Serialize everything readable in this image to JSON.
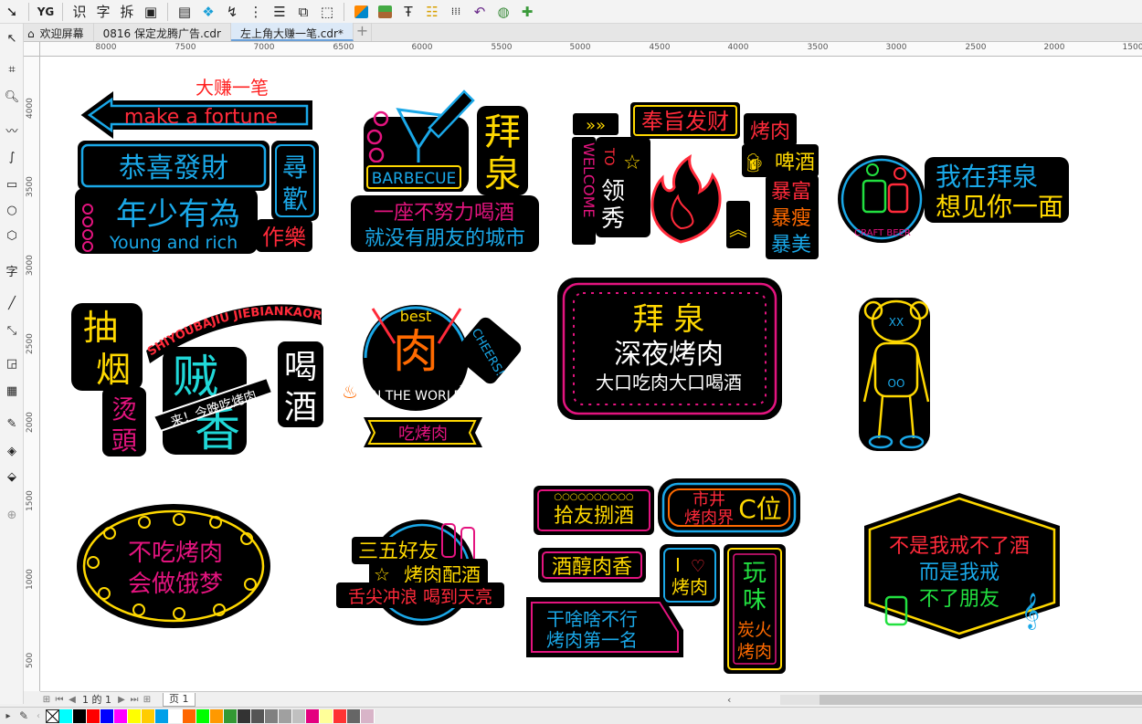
{
  "toolbar": {
    "items": [
      "select",
      "yg",
      "识",
      "字",
      "拆",
      "paste",
      "table",
      "dot",
      "step",
      "dist",
      "bar",
      "pos",
      "trim",
      "c1",
      "c2",
      "c3",
      "c4",
      "c5",
      "c6",
      "c7",
      "c8"
    ]
  },
  "tabs": {
    "home": "欢迎屏幕",
    "t1": "0816 保定龙腾广告.cdr",
    "t2": "左上角大赚一笔.cdr*",
    "add": "+"
  },
  "ruler": {
    "h": [
      "8000",
      "7500",
      "7000",
      "6500",
      "6000",
      "5500",
      "5000",
      "4500",
      "4000",
      "3500",
      "3000",
      "2500",
      "2000",
      "1500"
    ],
    "v": [
      "4000",
      "3500",
      "3000",
      "2500",
      "2000",
      "1500",
      "1000",
      "500"
    ]
  },
  "canvas": {
    "s1": {
      "title": "大赚一笔",
      "arrow": "make a fortune",
      "l1": "恭喜發財",
      "l2": "年少有為",
      "l3": "Young and rich",
      "v1": "尋",
      "v2": "歡",
      "v3": "作樂"
    },
    "s2": {
      "ch1": "拜",
      "ch2": "泉",
      "badge": "BARBECUE",
      "l1": "一座不努力喝酒",
      "l2": "就没有朋友的城市"
    },
    "s3": {
      "top": "奉旨发财",
      "side": "WELCOME",
      "to": "TO",
      "c1": "领",
      "c2": "秀",
      "r1": "烤肉",
      "r2": "啤酒",
      "r3": "暴富",
      "r4": "暴瘦",
      "r5": "暴美"
    },
    "s4": {
      "l1": "我在拜泉",
      "l2": "想见你一面",
      "tag": "CRAFT BEER"
    },
    "s5": {
      "arc": "SHIYOUBAJIU JIEBIANKAOROU",
      "a1": "抽",
      "a2": "烟",
      "b1": "喝",
      "b2": "酒",
      "c1": "烫",
      "c2": "頭",
      "big": "贼香",
      "ribbon": "来！今晚吃烤肉"
    },
    "s6": {
      "best": "best",
      "big": "肉",
      "arc": "IN THE WORLD",
      "cheers": "CHEERS!",
      "banner": "吃烤肉"
    },
    "s7": {
      "l1": "拜 泉",
      "l2": "深夜烤肉",
      "l3": "大口吃肉大口喝酒"
    },
    "s9": {
      "l1": "不吃烤肉",
      "l2": "会做饿梦"
    },
    "s10": {
      "l1": "三五好友",
      "l2": "烤肉配酒",
      "l3": "舌尖冲浪 喝到天亮"
    },
    "s11": {
      "a": "拾友捌酒",
      "b1": "市井",
      "b2": "烤肉界",
      "b3": "C位",
      "c": "酒醇肉香",
      "d1": "I",
      "d2": "烤肉",
      "e1": "干啥啥不行",
      "e2": "烤肉第一名",
      "f1": "玩",
      "f2": "味",
      "f3": "炭火",
      "f4": "烤肉"
    },
    "s12": {
      "l1": "不是我戒不了酒",
      "l2": "而是我戒",
      "l3": "不了朋友"
    }
  },
  "pagebar": {
    "page": "1 的 1",
    "tab": "页 1"
  },
  "palette": [
    "#00ffff",
    "#000000",
    "#ff0000",
    "#0000ff",
    "#ff00ff",
    "#ffff00",
    "#ffcc00",
    "#00a0e9",
    "#ffffff",
    "#ff6600",
    "#00ff00",
    "#ff9900",
    "#339933",
    "#333333",
    "#555555",
    "#808080",
    "#a0a0a0",
    "#c0c0c0",
    "#e4007f",
    "#ffff99",
    "#ff3333",
    "#666666",
    "#d8b4c8"
  ]
}
